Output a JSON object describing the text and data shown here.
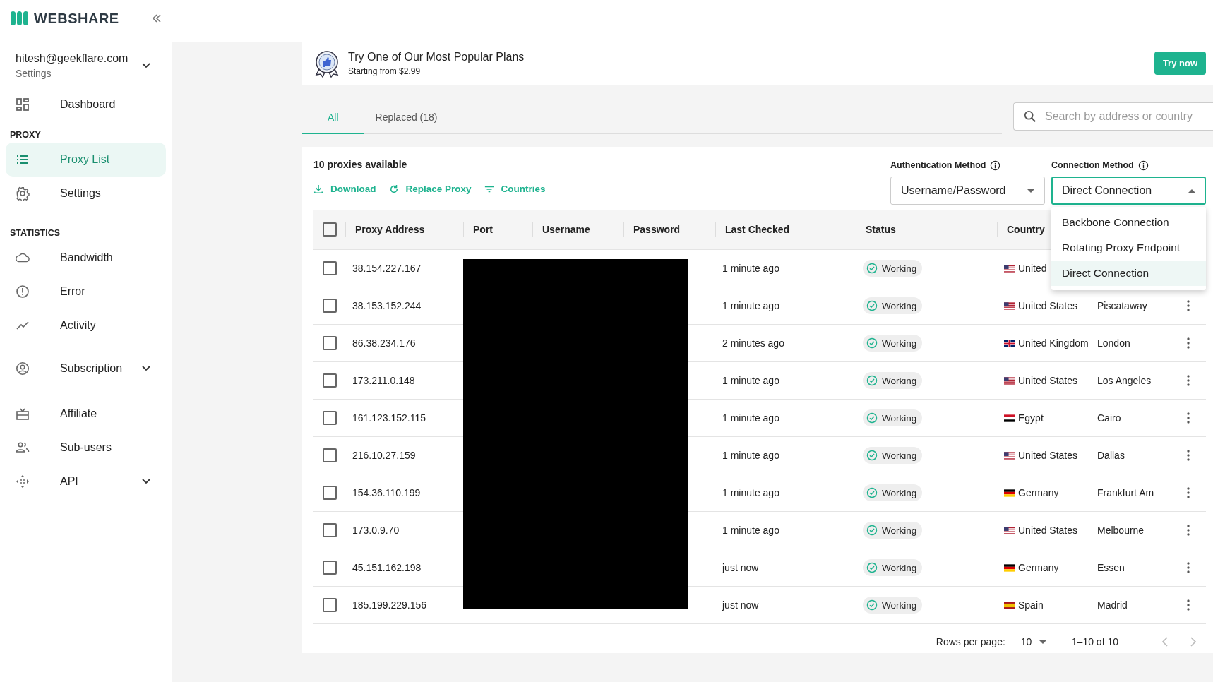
{
  "sidebar": {
    "brand": "WEBSHARE",
    "account": {
      "email": "hitesh@geekflare.com",
      "subtitle": "Settings",
      "expanded": false
    },
    "sections": [
      {
        "items": [
          {
            "label": "Dashboard",
            "selected": false
          }
        ]
      },
      {
        "title": "PROXY",
        "items": [
          {
            "label": "Proxy List",
            "selected": true
          },
          {
            "label": "Settings",
            "selected": false
          }
        ]
      },
      {
        "title": "STATISTICS",
        "divider": true,
        "items": [
          {
            "label": "Bandwidth",
            "selected": false
          },
          {
            "label": "Error",
            "selected": false
          },
          {
            "label": "Activity",
            "selected": false
          }
        ]
      },
      {
        "divider": true,
        "items": [
          {
            "label": "Subscription",
            "selected": false,
            "expanded": false
          },
          {
            "label": "Affiliate",
            "selected": false
          },
          {
            "label": "Sub-users",
            "selected": false
          },
          {
            "label": "API",
            "selected": false,
            "expanded": false
          }
        ]
      }
    ]
  },
  "banner": {
    "title": "Try One of Our Most Popular Plans",
    "subtitle": "Starting from $2.99",
    "button": "Try now"
  },
  "tabs": [
    {
      "label": "All",
      "selected": true
    },
    {
      "label": "Replaced (18)",
      "selected": false
    }
  ],
  "search": {
    "placeholder": "Search by address or country"
  },
  "panel": {
    "count": "10 proxies available",
    "actions": [
      "Download",
      "Replace Proxy",
      "Countries"
    ],
    "auth": {
      "label": "Authentication Method",
      "value": "Username/Password"
    },
    "connection": {
      "label": "Connection Method",
      "value": "Direct Connection",
      "expanded": true,
      "options": [
        {
          "label": "Backbone Connection",
          "selected": false
        },
        {
          "label": "Rotating Proxy Endpoint",
          "selected": false
        },
        {
          "label": "Direct Connection",
          "selected": true
        }
      ]
    }
  },
  "table": {
    "header_checked": false,
    "columns": [
      "Proxy Address",
      "Port",
      "Username",
      "Password",
      "Last Checked",
      "Status",
      "Country"
    ],
    "rows": [
      {
        "checked": false,
        "address": "38.154.227.167",
        "last_checked": "1 minute ago",
        "status": "Working",
        "kind": "us",
        "country": "United"
      },
      {
        "checked": false,
        "address": "38.153.152.244",
        "last_checked": "1 minute ago",
        "status": "Working",
        "kind": "us",
        "country": "United States",
        "city": "Piscataway"
      },
      {
        "checked": false,
        "address": "86.38.234.176",
        "last_checked": "2 minutes ago",
        "status": "Working",
        "kind": "gb",
        "country": "United Kingdom",
        "city": "London"
      },
      {
        "checked": false,
        "address": "173.211.0.148",
        "last_checked": "1 minute ago",
        "status": "Working",
        "kind": "us",
        "country": "United States",
        "city": "Los Angeles"
      },
      {
        "checked": false,
        "address": "161.123.152.115",
        "last_checked": "1 minute ago",
        "status": "Working",
        "kind": "eg",
        "country": "Egypt",
        "city": "Cairo"
      },
      {
        "checked": false,
        "address": "216.10.27.159",
        "last_checked": "1 minute ago",
        "status": "Working",
        "kind": "us",
        "country": "United States",
        "city": "Dallas"
      },
      {
        "checked": false,
        "address": "154.36.110.199",
        "last_checked": "1 minute ago",
        "status": "Working",
        "kind": "de",
        "country": "Germany",
        "city": "Frankfurt Am"
      },
      {
        "checked": false,
        "address": "173.0.9.70",
        "last_checked": "1 minute ago",
        "status": "Working",
        "kind": "us",
        "country": "United States",
        "city": "Melbourne"
      },
      {
        "checked": false,
        "address": "45.151.162.198",
        "last_checked": "just now",
        "status": "Working",
        "kind": "de",
        "country": "Germany",
        "city": "Essen"
      },
      {
        "checked": false,
        "address": "185.199.229.156",
        "last_checked": "just now",
        "status": "Working",
        "kind": "es",
        "country": "Spain",
        "city": "Madrid"
      }
    ]
  },
  "pagination": {
    "label": "Rows per page:",
    "rows": "10",
    "range": "1–10 of 10"
  }
}
